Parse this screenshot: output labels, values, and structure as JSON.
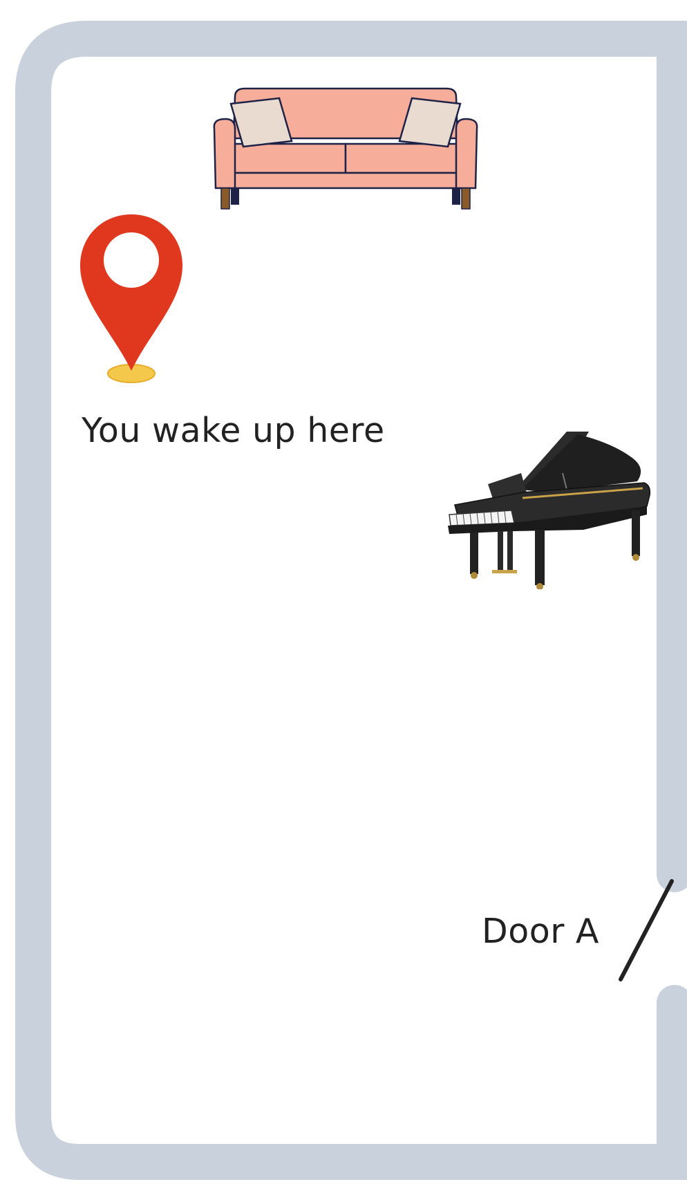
{
  "map": {
    "wake_label": "You wake up here",
    "door_label": "Door A"
  },
  "icons": {
    "location": "map-pin-icon",
    "sofa": "sofa-icon",
    "piano": "grand-piano-icon",
    "door": "door-swing-icon"
  },
  "colors": {
    "wall": "#c8d1dc",
    "pin": "#e0371f",
    "pin_base": "#f4c84a",
    "sofa": "#f6ad9a",
    "piano": "#2b2b2b",
    "text": "#222222"
  }
}
